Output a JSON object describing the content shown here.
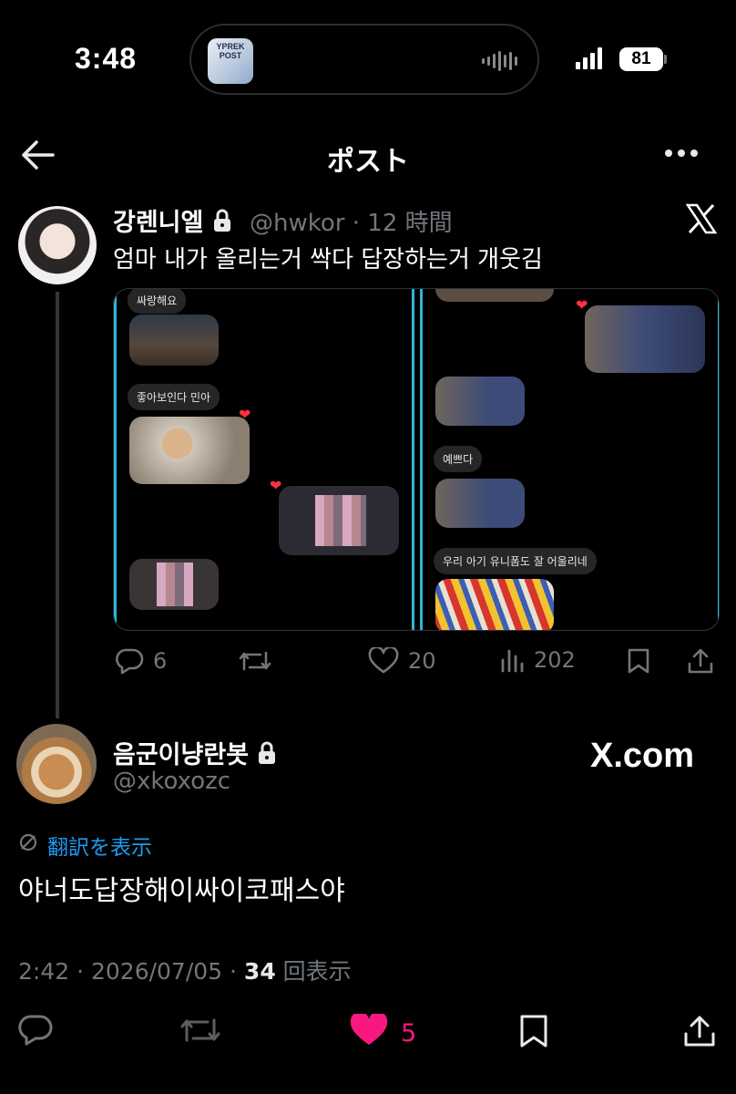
{
  "status_bar": {
    "time": "3:48",
    "battery": "81",
    "island_art_text": "YPREK POST"
  },
  "header": {
    "title": "ポスト"
  },
  "post": {
    "author_name": "강렌니엘",
    "handle": "@hwkor",
    "separator": "·",
    "age": "12 時間",
    "text": "엄마 내가 올리는거 싹다 답장하는거 개웃김",
    "media": {
      "left_bubbles": [
        "싸랑해요",
        "좋아보인다 민아"
      ],
      "right_bubbles": [
        "예쁘다",
        "우리 아기 유니폼도 잘 어울리네"
      ]
    },
    "stats": {
      "replies": "6",
      "likes": "20",
      "views": "202"
    }
  },
  "reply": {
    "author_name": "음군이냥란봇",
    "handle": "@xkoxozc",
    "site": "X.com",
    "translate_label": "翻訳を表示",
    "text": "야너도답장해이싸이코패스야",
    "meta_time": "2:42 · 2026/07/05 · ",
    "meta_views": "34",
    "meta_views_label": " 回表示",
    "likes": "5"
  },
  "colors": {
    "accent": "#1d9bf0",
    "like": "#f91880",
    "muted": "#71767b",
    "media_border": "#2fb5d9"
  },
  "icons": [
    "back-arrow-icon",
    "more-icon",
    "lock-icon",
    "x-logo-icon",
    "reply-icon",
    "repost-icon",
    "heart-icon",
    "views-icon",
    "bookmark-icon",
    "share-icon",
    "translate-icon"
  ]
}
